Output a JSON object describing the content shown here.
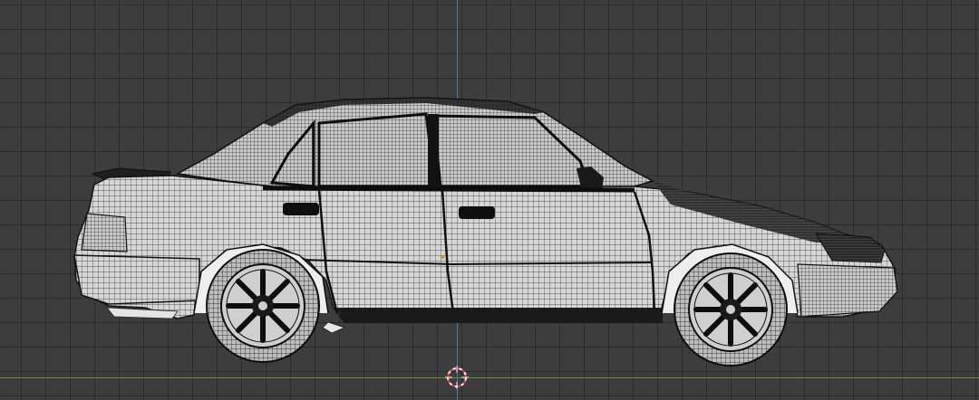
{
  "viewport": {
    "view": "orthographic-side",
    "grid": true,
    "colors": {
      "background": "#3d3d3d",
      "grid_line": "#2a2a2a",
      "z_axis": "#4f78c2",
      "y_axis": "#6b8e3e",
      "mesh_fill": "#dcdcdc",
      "mesh_wire": "#1a1a1a",
      "cursor_red": "#d24a3c",
      "origin": "#e08a2c"
    }
  },
  "scene": {
    "object": "sedan-car-mesh",
    "display_mode": "wireframe-over-solid"
  },
  "icons": {
    "cursor": "3d-cursor-icon",
    "origin": "object-origin-icon"
  }
}
